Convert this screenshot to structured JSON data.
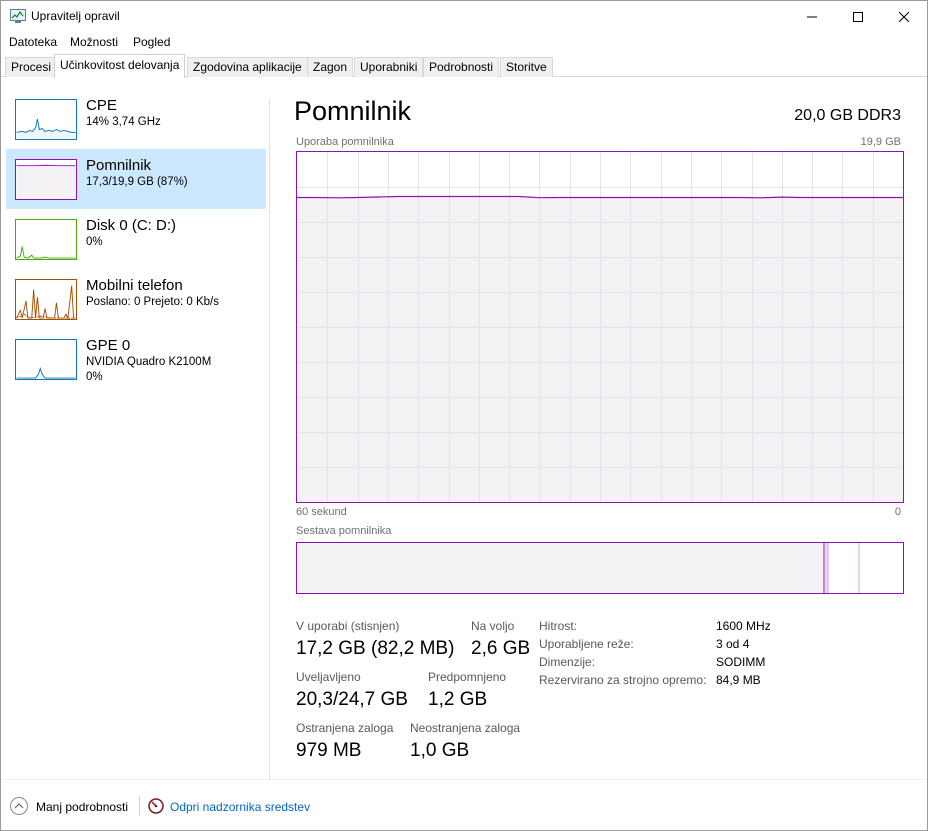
{
  "window": {
    "title": "Upravitelj opravil"
  },
  "menu": [
    "Datoteka",
    "Možnosti",
    "Pogled"
  ],
  "tabs": [
    "Procesi",
    "Učinkovitost delovanja",
    "Zgodovina aplikacije",
    "Zagon",
    "Uporabniki",
    "Podrobnosti",
    "Storitve"
  ],
  "active_tab": "Učinkovitost delovanja",
  "sidebar": {
    "items": [
      {
        "name": "CPE",
        "sub": "14% 3,74 GHz",
        "sub2": "",
        "color": "#1179b3",
        "icon": "cpe-graph-thumbnail"
      },
      {
        "name": "Pomnilnik",
        "sub": "17,3/19,9 GB (87%)",
        "sub2": "",
        "color": "#8b12ae",
        "icon": "memory-graph-thumbnail"
      },
      {
        "name": "Disk 0 (C: D:)",
        "sub": "0%",
        "sub2": "",
        "color": "#4da60c",
        "icon": "disk-graph-thumbnail"
      },
      {
        "name": "Mobilni telefon",
        "sub": "Poslano: 0 Prejeto: 0 Kb/s",
        "sub2": "",
        "color": "#a74f01",
        "icon": "network-graph-thumbnail"
      },
      {
        "name": "GPE 0",
        "sub": "NVIDIA Quadro K2100M",
        "sub2": "0%",
        "color": "#1179b3",
        "icon": "gpu-graph-thumbnail"
      }
    ]
  },
  "main": {
    "title": "Pomnilnik",
    "spec": "20,0 GB DDR3",
    "graph_label": "Uporaba pomnilnika",
    "graph_max": "19,9 GB",
    "time_left": "60 sekund",
    "time_right": "0",
    "composition_label": "Sestava pomnilnika",
    "usage_fraction": 0.87
  },
  "stats": {
    "in_use_label": "V uporabi (stisnjen)",
    "in_use_value": "17,2 GB (82,2 MB)",
    "available_label": "Na voljo",
    "available_value": "2,6 GB",
    "committed_label": "Uveljavljeno",
    "committed_value": "20,3/24,7 GB",
    "cached_label": "Predpomnjeno",
    "cached_value": "1,2 GB",
    "paged_label": "Ostranjena zaloga",
    "paged_value": "979 MB",
    "nonpaged_label": "Neostranjena zaloga",
    "nonpaged_value": "1,0 GB"
  },
  "details": {
    "speed_label": "Hitrost:",
    "speed_value": "1600 MHz",
    "slots_label": "Uporabljene reže:",
    "slots_value": "3 od 4",
    "form_label": "Dimenzije:",
    "form_value": "SODIMM",
    "reserved_label": "Rezervirano za strojno opremo:",
    "reserved_value": "84,9 MB"
  },
  "footer": {
    "fewer_label": "Manj podrobnosti",
    "resmon_label": "Odpri nadzornika sredstev"
  },
  "colors": {
    "memory": "#8b12ae",
    "memory_fill": "#f4f2f4",
    "selected": "#cce8ff",
    "link": "#0066cc"
  }
}
